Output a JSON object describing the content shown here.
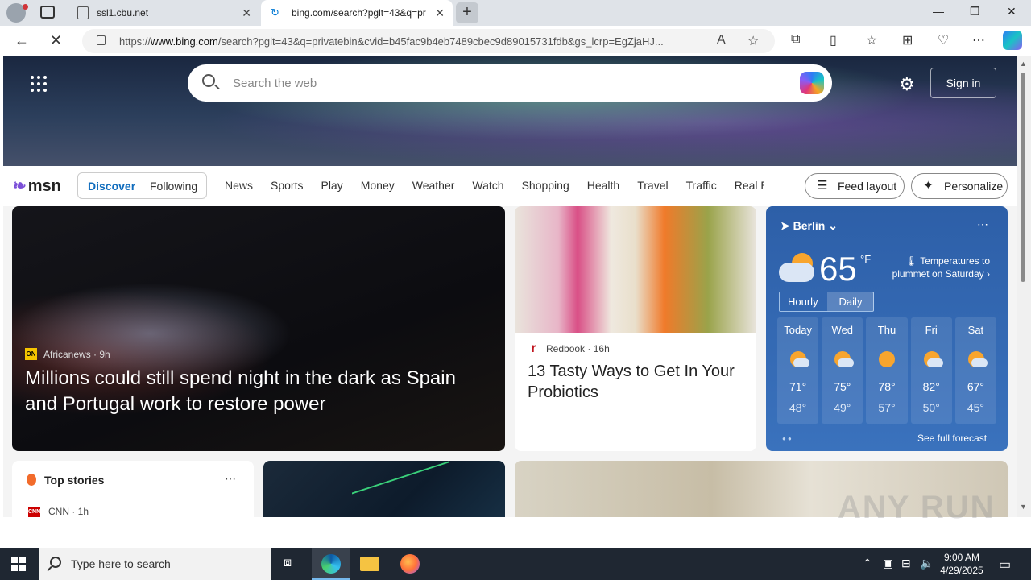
{
  "browser": {
    "tabs": [
      {
        "title": "ssl1.cbu.net"
      },
      {
        "title": "bing.com/search?pglt=43&q=pr"
      }
    ],
    "url_prefix": "https://",
    "url_domain": "www.bing.com",
    "url_rest": "/search?pglt=43&q=privatebin&cvid=b45fac9b4eb7489cbec9d89015731fdb&gs_lcrp=EgZjaHJ..."
  },
  "bing": {
    "search_placeholder": "Search the web",
    "signin_label": "Sign in"
  },
  "msn": {
    "logo": "msn",
    "discover": "Discover",
    "following": "Following",
    "nav": [
      "News",
      "Sports",
      "Play",
      "Money",
      "Weather",
      "Watch",
      "Shopping",
      "Health",
      "Travel",
      "Traffic",
      "Real E"
    ],
    "feed_layout": "Feed layout",
    "personalize": "Personalize"
  },
  "main_story": {
    "source": "Africanews",
    "source_logo": "ON",
    "age": "9h",
    "title": "Millions could still spend night in the dark as Spain and Portugal work to restore power"
  },
  "food_story": {
    "source": "Redbook",
    "age": "16h",
    "title": "13 Tasty Ways to Get In Your Probiotics"
  },
  "weather": {
    "location": "Berlin",
    "temp": "65",
    "unit": "°F",
    "alert": "Temperatures to plummet on Saturday",
    "tab_hourly": "Hourly",
    "tab_daily": "Daily",
    "days": [
      {
        "name": "Today",
        "hi": "71°",
        "lo": "48°",
        "icon": "partly-cloudy-icon"
      },
      {
        "name": "Wed",
        "hi": "75°",
        "lo": "49°",
        "icon": "partly-cloudy-icon"
      },
      {
        "name": "Thu",
        "hi": "78°",
        "lo": "57°",
        "icon": "sunny-icon"
      },
      {
        "name": "Fri",
        "hi": "82°",
        "lo": "50°",
        "icon": "partly-cloudy-icon"
      },
      {
        "name": "Sat",
        "hi": "67°",
        "lo": "45°",
        "icon": "partly-cloudy-icon"
      }
    ],
    "full_forecast": "See full forecast"
  },
  "top_stories": {
    "title": "Top stories",
    "source": "CNN",
    "age": "1h"
  },
  "watermark": "ANY RUN",
  "taskbar": {
    "search_placeholder": "Type here to search",
    "time": "9:00 AM",
    "date": "4/29/2025"
  }
}
